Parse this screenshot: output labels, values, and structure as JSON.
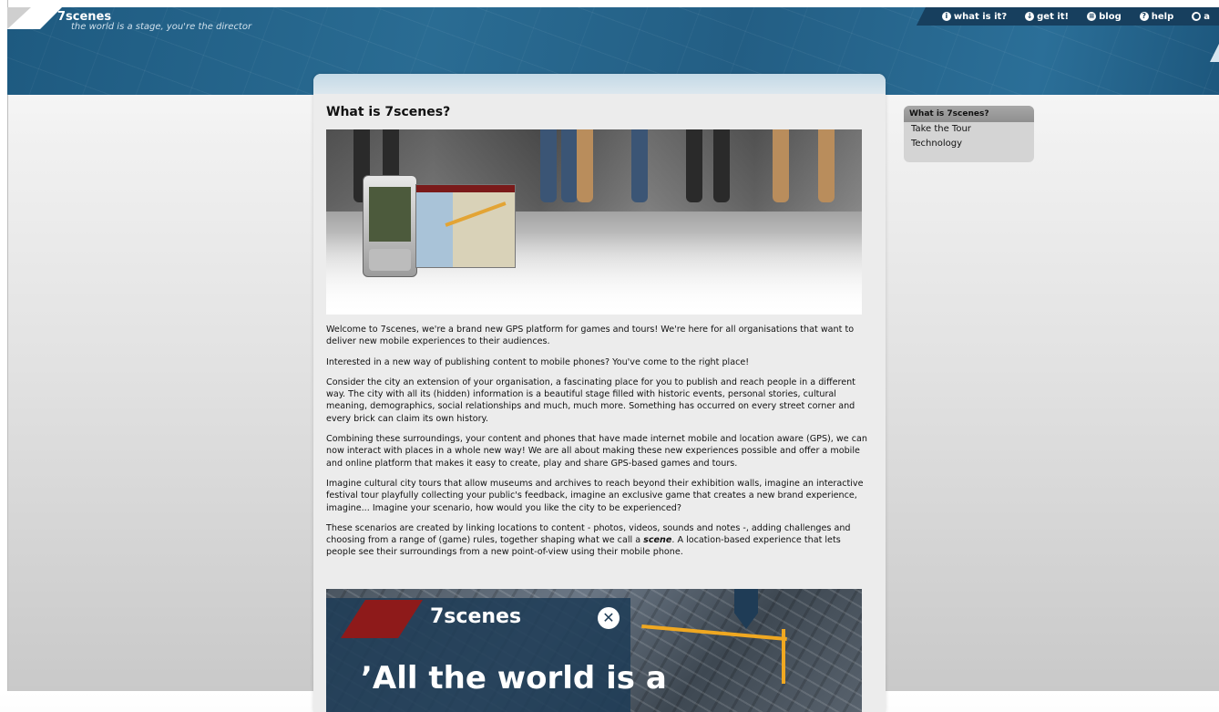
{
  "header": {
    "brand": "7scenes",
    "tagline": "the world is a stage, you're the director",
    "nav": [
      {
        "label": "what is it?",
        "icon": "info-icon",
        "glyph": "i"
      },
      {
        "label": "get it!",
        "icon": "download-icon",
        "glyph": "↓"
      },
      {
        "label": "blog",
        "icon": "blog-icon",
        "glyph": "≡"
      },
      {
        "label": "help",
        "icon": "help-icon",
        "glyph": "?"
      },
      {
        "label": "a",
        "icon": "account-icon",
        "glyph": "●"
      }
    ]
  },
  "main": {
    "title": "What is 7scenes?",
    "paragraphs": [
      "Welcome to 7scenes, we're a brand new GPS platform for games and tours! We're here for all organisations that want to deliver new mobile experiences to their audiences.",
      "Interested in a new way of publishing content to mobile phones? You've come to the right place!",
      "Consider the city an extension of your organisation, a fascinating place for you to publish and reach people in a different way. The city with all its (hidden) information is a beautiful stage filled with historic events, personal stories, cultural meaning, demographics, social relationships and much, much more. Something has occurred on every street corner and every brick can claim its own history.",
      "Combining these surroundings, your content and phones that have made internet mobile and location aware (GPS), we can now interact with places in a whole new way! We are all about making these new experiences possible and offer a mobile and online platform that makes it easy to create, play and share GPS-based games and tours.",
      "Imagine cultural city tours that allow museums and archives to reach beyond their exhibition walls, imagine an interactive festival tour playfully collecting your public's feedback, imagine an exclusive game that creates a new brand experience, imagine... Imagine your scenario, how would you like the city to be experienced?"
    ],
    "last_paragraph": {
      "before": "These scenarios are created by linking locations to content - photos, videos, sounds and notes -, adding challenges and choosing from a range of (game) rules, together shaping what we call a ",
      "emphasis": "scene",
      "after": ". A location-based experience that lets people see their surroundings from a new point-of-view using their mobile phone."
    },
    "video": {
      "brand": "7scenes",
      "close_glyph": "✕",
      "quote": "’All the world is a"
    }
  },
  "sidebar": {
    "heading": "What is 7scenes?",
    "items": [
      "Take the Tour",
      "Technology"
    ]
  }
}
